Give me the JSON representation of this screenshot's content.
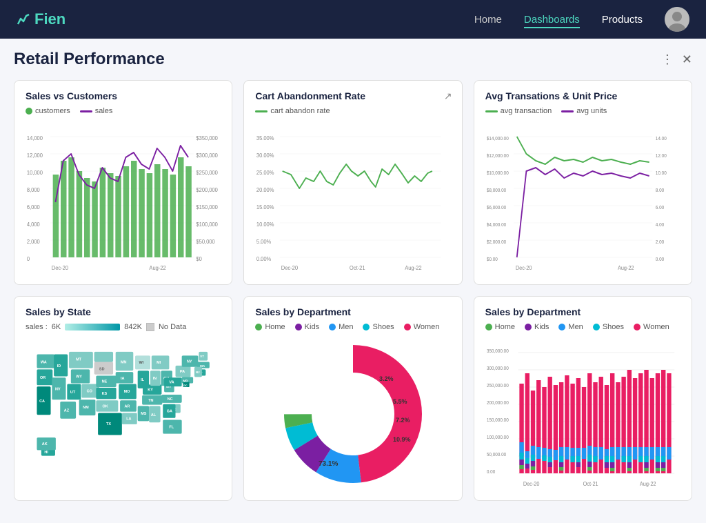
{
  "header": {
    "logo": "Fien",
    "nav": [
      {
        "label": "Home",
        "active": false
      },
      {
        "label": "Dashboards",
        "active": true
      },
      {
        "label": "Products",
        "active": false
      }
    ]
  },
  "page": {
    "title": "Retail Performance",
    "more_icon": "⋮",
    "close_icon": "✕"
  },
  "charts": {
    "sales_vs_customers": {
      "title": "Sales vs Customers",
      "legend": [
        {
          "label": "customers",
          "color": "#4caf50",
          "type": "bar"
        },
        {
          "label": "sales",
          "color": "#7b1fa2",
          "type": "line"
        }
      ],
      "x_labels": [
        "Dec-20",
        "Aug-22"
      ],
      "y_left_labels": [
        "0",
        "2,000",
        "4,000",
        "6,000",
        "8,000",
        "10,000",
        "12,000",
        "14,000"
      ],
      "y_right_labels": [
        "$0",
        "$50,000",
        "$100,000",
        "$150,000",
        "$200,000",
        "$250,000",
        "$300,000",
        "$350,000"
      ]
    },
    "cart_abandonment": {
      "title": "Cart Abandonment Rate",
      "legend": [
        {
          "label": "cart abandon rate",
          "color": "#4caf50",
          "type": "line"
        }
      ],
      "x_labels": [
        "Dec-20",
        "Oct-21",
        "Aug-22"
      ],
      "y_labels": [
        "0.00%",
        "5.00%",
        "10.00%",
        "15.00%",
        "20.00%",
        "25.00%",
        "30.00%",
        "35.00%"
      ]
    },
    "avg_transactions": {
      "title": "Avg Transations & Unit Price",
      "legend": [
        {
          "label": "avg transaction",
          "color": "#4caf50",
          "type": "line"
        },
        {
          "label": "avg units",
          "color": "#7b1fa2",
          "type": "line"
        }
      ],
      "x_labels": [
        "Dec-20",
        "Aug-22"
      ],
      "y_left_labels": [
        "$0.00",
        "$2,000.00",
        "$4,000.00",
        "$6,000.00",
        "$8,000.00",
        "$10,000.00",
        "$12,000.00",
        "$14,000.00"
      ],
      "y_right_labels": [
        "0.00",
        "2.00",
        "4.00",
        "6.00",
        "8.00",
        "10.00",
        "12.00",
        "14.00"
      ]
    },
    "sales_by_state": {
      "title": "Sales by State",
      "legend_min": "6K",
      "legend_max": "842K",
      "legend_nodata": "No Data"
    },
    "sales_by_dept_donut": {
      "title": "Sales by Department",
      "legend": [
        {
          "label": "Home",
          "color": "#4caf50"
        },
        {
          "label": "Kids",
          "color": "#7b1fa2"
        },
        {
          "label": "Men",
          "color": "#2196f3"
        },
        {
          "label": "Shoes",
          "color": "#00bcd4"
        },
        {
          "label": "Women",
          "color": "#e91e63"
        }
      ],
      "segments": [
        {
          "label": "Women",
          "value": 73.1,
          "color": "#e91e63"
        },
        {
          "label": "Men",
          "value": 10.9,
          "color": "#2196f3"
        },
        {
          "label": "Kids",
          "value": 7.2,
          "color": "#7b1fa2"
        },
        {
          "label": "Shoes",
          "value": 5.5,
          "color": "#00bcd4"
        },
        {
          "label": "Home",
          "value": 3.2,
          "color": "#4caf50"
        }
      ]
    },
    "sales_by_dept_bar": {
      "title": "Sales by Department",
      "legend": [
        {
          "label": "Home",
          "color": "#4caf50"
        },
        {
          "label": "Kids",
          "color": "#7b1fa2"
        },
        {
          "label": "Men",
          "color": "#2196f3"
        },
        {
          "label": "Shoes",
          "color": "#00bcd4"
        },
        {
          "label": "Women",
          "color": "#e91e63"
        }
      ],
      "x_labels": [
        "Dec-20",
        "Oct-21",
        "Aug-22"
      ],
      "y_labels": [
        "0.00",
        "50,000.00",
        "100,000.00",
        "150,000.00",
        "200,000.00",
        "250,000.00",
        "300,000.00",
        "350,000.00"
      ]
    }
  }
}
